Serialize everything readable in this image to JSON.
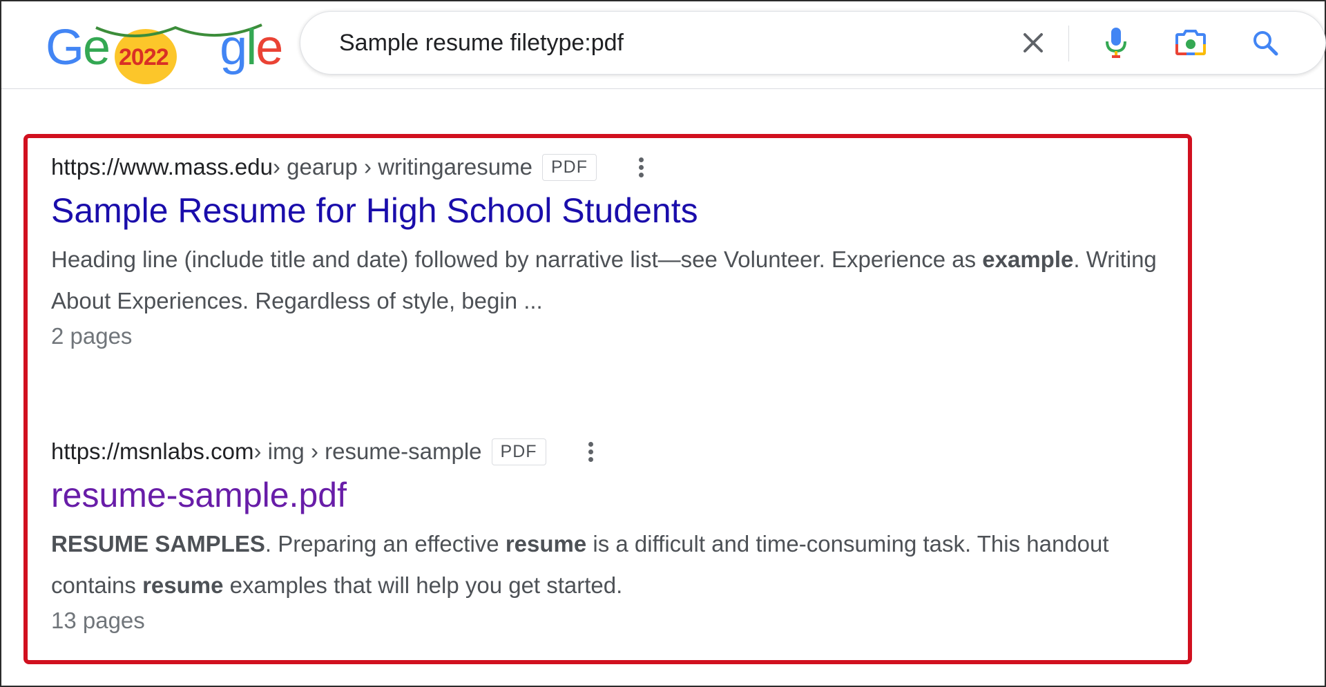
{
  "logo": {
    "text": "Google",
    "doodle_year": "2022"
  },
  "search": {
    "query": "Sample resume filetype:pdf"
  },
  "icons": {
    "clear": "close-icon",
    "voice": "microphone-icon",
    "lens": "camera-icon",
    "search": "search-icon"
  },
  "colors": {
    "accent_red": "#d1101f",
    "link_unvisited": "#1a0dab",
    "link_visited": "#681da8",
    "google_blue": "#4285f4",
    "google_red": "#ea4335",
    "google_yellow": "#fbbc05",
    "google_green": "#34a853"
  },
  "results": [
    {
      "domain": "https://www.mass.edu",
      "path": " › gearup › writingaresume",
      "badge": "PDF",
      "title": "Sample Resume for High School Students",
      "snippet": [
        {
          "text": "Heading line (include title and date) followed by narrative list—see Volunteer. Experience as ",
          "bold": false
        },
        {
          "text": "example",
          "bold": true
        },
        {
          "text": ". Writing About Experiences. Regardless of style, begin ...",
          "bold": false
        }
      ],
      "pages": "2 pages"
    },
    {
      "domain": "https://msnlabs.com",
      "path": " › img › resume-sample",
      "badge": "PDF",
      "title": "resume-sample.pdf",
      "snippet": [
        {
          "text": "RESUME SAMPLES",
          "bold": true
        },
        {
          "text": ". Preparing an effective ",
          "bold": false
        },
        {
          "text": "resume",
          "bold": true
        },
        {
          "text": " is a difficult and time-consuming task. This handout contains ",
          "bold": false
        },
        {
          "text": "resume",
          "bold": true
        },
        {
          "text": " examples that will help you get started.",
          "bold": false
        }
      ],
      "pages": "13 pages"
    }
  ]
}
